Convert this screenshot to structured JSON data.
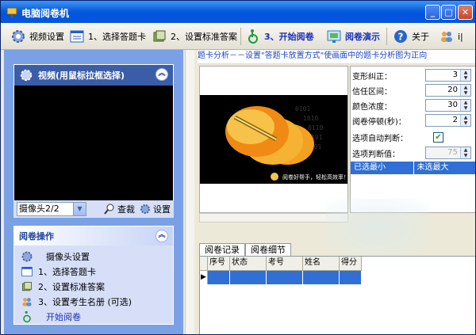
{
  "window": {
    "title": "电脑阅卷机"
  },
  "toolbar": {
    "video_settings": "视频设置",
    "select_card": "1、选择答题卡",
    "set_answer": "2、设置标准答案",
    "start_marking": "3、开始阅卷",
    "demo": "阅卷演示",
    "about": "关于",
    "extra": "i|"
  },
  "video_panel": {
    "title": "视频(用鼠标拉框选择)",
    "camera_select": "摄像头2/2",
    "search_label": "查裁",
    "settings_label": "设置"
  },
  "ops_panel": {
    "title": "阅卷操作",
    "items": [
      {
        "label": "摄像头设置",
        "icon": "gear-icon"
      },
      {
        "label": "1、选择答题卡",
        "icon": "card-icon"
      },
      {
        "label": "2、设置标准答案",
        "icon": "answer-icon"
      },
      {
        "label": "3、设置考生名册 (可选)",
        "icon": "users-icon"
      },
      {
        "label": "开始阅卷",
        "icon": "start-icon"
      }
    ]
  },
  "hint": "题卡分析－－设置\"答题卡放置方式\"使画面中的题卡分析图为正向",
  "settings": {
    "rows": [
      {
        "label": "变形纠正：",
        "value": "3"
      },
      {
        "label": "信任区间：",
        "value": "20"
      },
      {
        "label": "颜色浓度：",
        "value": "30"
      },
      {
        "label": "阅卷停顿(秒)：",
        "value": "2"
      }
    ],
    "auto_judge_label": "选项自动判断：",
    "auto_judge_checked": true,
    "judge_threshold_label": "选项判断值：",
    "judge_threshold_value": "75",
    "min_selected": "已选最小",
    "max_unselected": "未选最大"
  },
  "tabs": [
    "阅卷记录",
    "阅卷细节"
  ],
  "grid": {
    "columns": [
      "序号",
      "状态",
      "考号",
      "姓名",
      "得分"
    ]
  },
  "logo_text": "阅卷好帮手，轻松高效率！"
}
